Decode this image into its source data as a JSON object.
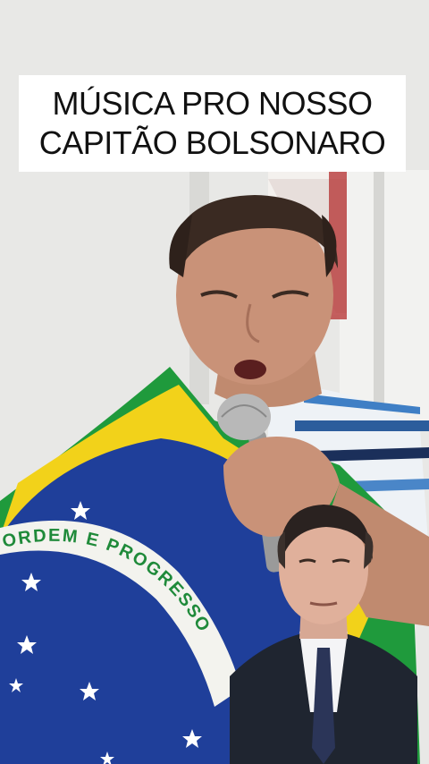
{
  "caption": {
    "line1": "MÚSICA PRO NOSSO",
    "line2": "CAPITÃO BOLSONARO"
  },
  "flag": {
    "banner_text": "ORDEM E PROGRESSO"
  },
  "colors": {
    "flag_green": "#1f9a3c",
    "flag_yellow": "#f2d21a",
    "flag_blue": "#1f3f9a",
    "banner_white": "#f3f3ee",
    "banner_text": "#1f8a3a",
    "caption_bg": "#ffffff",
    "caption_text": "#111111"
  }
}
